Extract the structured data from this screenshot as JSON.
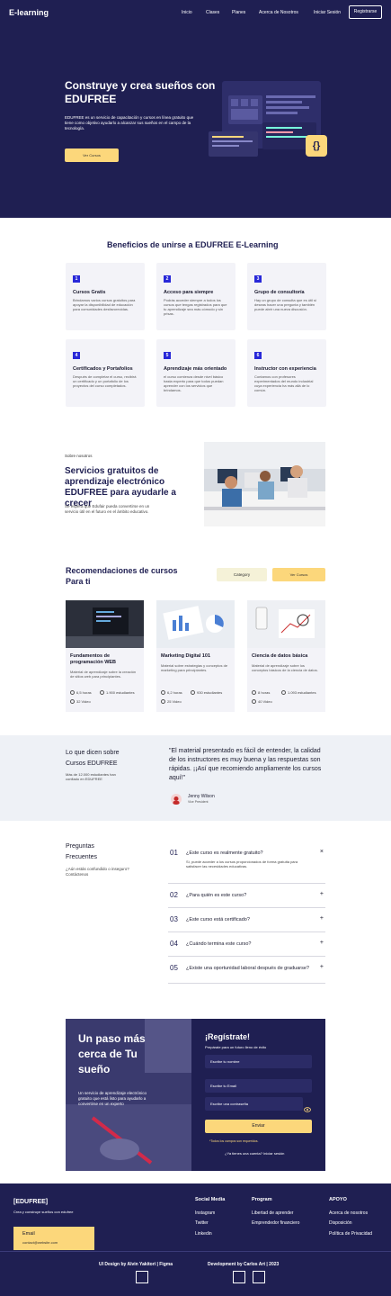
{
  "nav": {
    "brand": "E-learning",
    "links": [
      "Inicio",
      "Clases",
      "Planes",
      "Acerca de Nosotros",
      "Iniciar Sesión"
    ],
    "register": "Registrarse"
  },
  "hero": {
    "title": "Construye y crea sueños con EDUFREE",
    "description": "EDUFREE es un servicio de capacitación y cursos en línea gratuito que tiene como objetivo ayudarlo a alcanzar sus sueños en el campo de la tecnología.",
    "cta": "Ver Cursos",
    "code_icon": "{}"
  },
  "benefits": {
    "title": "Beneficios de unirse a EDUFREE E-Learning",
    "items": [
      {
        "num": "1",
        "title": "Cursos Gratis",
        "text": "Brindamos varios cursos gratuitos para apoyar la disponibilidad de educación para comunidades desfavorecidas."
      },
      {
        "num": "2",
        "title": "Acceso para siempre",
        "text": "Podrás acceder siempre a todos los cursos que tengas registrados para que tu aprendizaje sea más cómodo y sin prisas."
      },
      {
        "num": "3",
        "title": "Grupo de consultoría",
        "text": "Hay un grupo de consulta que es útil si deseas hacer una pregunta y también puede abrir una nueva discusión."
      },
      {
        "num": "4",
        "title": "Certificados y Portafolios",
        "text": "Después de completar el curso, recibirá un certificado y un portafolio de los proyectos del curso completados."
      },
      {
        "num": "5",
        "title": "Aprendizaje más orientado",
        "text": "el curso comienza desde nivel básico hasta experto para que todos puedan aprender con los servicios que brindamos."
      },
      {
        "num": "6",
        "title": "Instructor con experiencia",
        "text": "Contamos con profesores experimentados del mundo industrial cuya experiencia ha más allá de lo común."
      }
    ]
  },
  "about": {
    "label": "Sobre nosotros",
    "title": "Servicios gratuitos de aprendizaje electrónico EDUFREE para ayudarle a crecer",
    "text": "Se espera que Edufair pueda convertirse en un servicio útil en el futuro en el ámbito educativo."
  },
  "courses": {
    "title": "Recomendaciones de cursos Para ti",
    "category_btn": "Category",
    "view_btn": "Ver Cursos",
    "items": [
      {
        "title": "Fundamentos de programación WEB",
        "text": "Material de aprendizaje sobre la creación de sitios web para principiantes.",
        "hours": "6,5 horas",
        "students": "1.900 estudiantes",
        "videos": "32 Video"
      },
      {
        "title": "Marketing Digital 101",
        "text": "Material sobre estrategias y conceptos de marketing para principiantes.",
        "hours": "6,2 horas",
        "students": "930 estudiantes",
        "videos": "25 Video"
      },
      {
        "title": "Ciencia de datos básica",
        "text": "Material de aprendizaje sobre los conceptos básicos de la ciencia de datos.",
        "hours": "8 horas",
        "students": "1.093 estudiantes",
        "videos": "40 Video"
      }
    ]
  },
  "testimonial": {
    "heading": "Lo que dicen sobre Cursos EDUFREE",
    "sub": "Más de 12.000 estudiantes han confiado en EDUFREE",
    "quote": "\"El material presentado es fácil de entender, la calidad de los instructores es muy buena y las respuestas son rápidas. ¡¡Así que recomiendo ampliamente los cursos aquí!\"",
    "name": "Jenny Wilson",
    "role": "Vice President"
  },
  "faq": {
    "title": "Preguntas Frecuentes",
    "sub": "¿Aún estás confundido o inseguro? Contáctenos",
    "items": [
      {
        "num": "01",
        "q": "¿Este curso es realmente gratuito?",
        "a": "Sí, puede acceder a los cursos proporcionados de forma gratuita para satisfacer las necesidades educativas.",
        "sign": "×"
      },
      {
        "num": "02",
        "q": "¿Para quién es este curso?",
        "sign": "+"
      },
      {
        "num": "03",
        "q": "¿Este curso está certificado?",
        "sign": "+"
      },
      {
        "num": "04",
        "q": "¿Cuándo termina este curso?",
        "sign": "+"
      },
      {
        "num": "05",
        "q": "¿Existe una oportunidad laboral después de graduarse?",
        "sign": "+"
      }
    ]
  },
  "cta": {
    "title": "Un paso más cerca de Tu sueño",
    "text": "Un servicio de aprendizaje electrónico gratuito que está listo para ayudarlo a convertirse en un experto",
    "form_title": "¡Regístrate!",
    "form_sub": "Prepárate para un futuro lleno de éxito",
    "name_placeholder": "Escribe tu nombre",
    "email_placeholder": "Escribe tu Email",
    "password_placeholder": "Escribe una contraseña",
    "submit": "Enviar",
    "note": "*Todos los campos son requeridos.",
    "login": "¿Ya tienes una cuenta? Iniciar sesión"
  },
  "footer": {
    "brand": "[EDUFREE]",
    "tagline": "Crea y construye sueños con edufree",
    "email_label": "Email",
    "email": "contact@website.com",
    "cols": [
      {
        "title": "Social Media",
        "links": [
          "Instagram",
          "Twitter",
          "Linkedin"
        ]
      },
      {
        "title": "Program",
        "links": [
          "Libertad de aprender",
          "Emprendedor financiero"
        ]
      },
      {
        "title": "APOYO",
        "links": [
          "Acerca de nosotros",
          "Disposición",
          "Política de Privacidad"
        ]
      }
    ],
    "credit_design": "UI Design by Alvin Yakitori | Figma",
    "credit_dev": "Development by Carlos Art | 2023"
  },
  "colors": {
    "navy": "#1f1f52",
    "accent": "#fcd77b",
    "blue": "#2828d8"
  }
}
